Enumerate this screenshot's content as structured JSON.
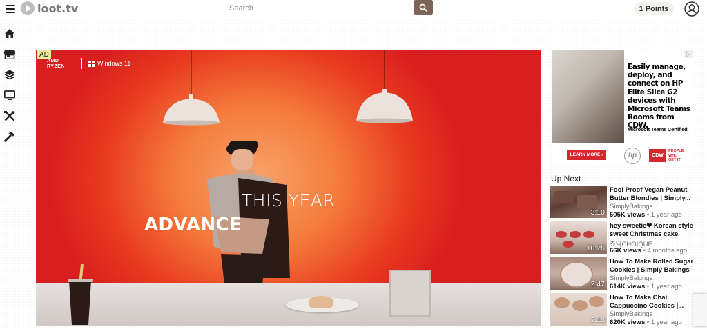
{
  "header": {
    "logo_text": "loot.tv",
    "search_placeholder": "Search",
    "points_label": "1 Points"
  },
  "sidebar": {
    "items": [
      {
        "icon": "home-icon"
      },
      {
        "icon": "store-icon"
      },
      {
        "icon": "layers-icon"
      },
      {
        "icon": "monitor-icon"
      },
      {
        "icon": "tools-icon"
      },
      {
        "icon": "hammer-icon"
      }
    ]
  },
  "player": {
    "ad_badge": "AD",
    "brand_amd_line1": "AMD",
    "brand_amd_line2": "RYZEN",
    "brand_windows": "Windows 11",
    "headline_1": "THIS YEAR",
    "headline_2": "ADVANCE"
  },
  "side_ad": {
    "close_label": "▷",
    "text": "Easily manage, deploy, and connect on HP Elite Slice G2 devices with Microsoft Teams Rooms from CDW.",
    "certified": "Microsoft Teams Certified.",
    "cta": "LEARN MORE ›",
    "hp_logo": "hp",
    "cdw_logo": "CDW",
    "people_line1": "PEOPLE",
    "people_line2": "WHO",
    "people_line3": "GET IT"
  },
  "up_next": {
    "heading": "Up Next",
    "videos": [
      {
        "title": "Fool Proof Vegan Peanut Butter Blondies | Simply...",
        "channel": "SimplyBakings",
        "views": "605K views",
        "age": "1 year ago",
        "duration": "3:10"
      },
      {
        "title": "hey sweetie❤ Korean style sweet Christmas cake",
        "channel": "쵸익CHOIQUE",
        "views": "66K views",
        "age": "4 months ago",
        "duration": "10:26"
      },
      {
        "title": "How To Make Rolled Sugar Cookies | Simply Bakings",
        "channel": "SimplyBakings",
        "views": "614K views",
        "age": "1 year ago",
        "duration": "2:47"
      },
      {
        "title": "How To Make Chai Cappuccino Cookies |...",
        "channel": "SimplyBakings",
        "views": "620K views",
        "age": "1 year ago",
        "duration": "2:13"
      }
    ]
  },
  "colors": {
    "search_button": "#7d6458",
    "player_red": "#e8391f",
    "player_orange": "#f47b3d",
    "ad_red": "#d7262d"
  }
}
